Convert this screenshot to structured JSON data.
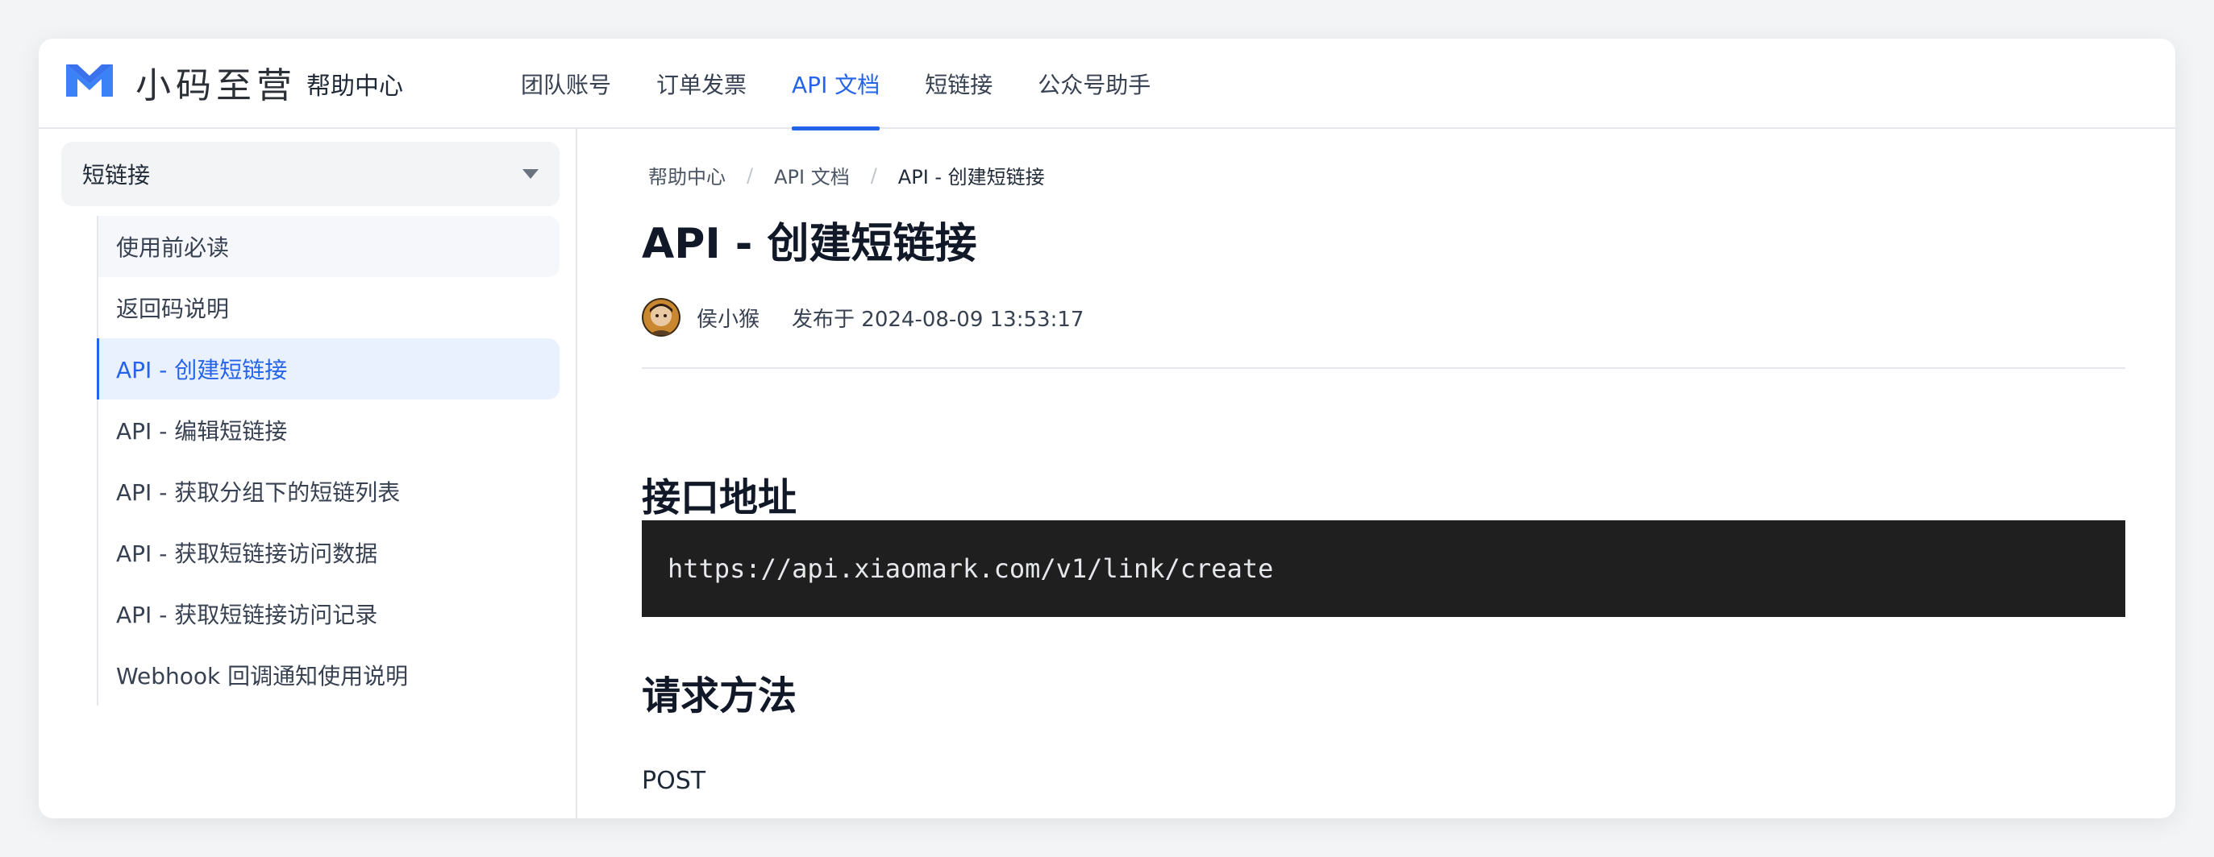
{
  "brand": {
    "logo_text": "小码至营",
    "logo_color": "#3b82f6"
  },
  "header": {
    "help_title": "帮助中心",
    "nav": [
      {
        "label": "团队账号",
        "active": false
      },
      {
        "label": "订单发票",
        "active": false
      },
      {
        "label": "API 文档",
        "active": true
      },
      {
        "label": "短链接",
        "active": false
      },
      {
        "label": "公众号助手",
        "active": false
      }
    ]
  },
  "sidebar": {
    "group_label": "短链接",
    "group_icon": "caret-down-icon",
    "items": [
      {
        "label": "使用前必读",
        "state": "hover"
      },
      {
        "label": "返回码说明",
        "state": ""
      },
      {
        "label": "API - 创建短链接",
        "state": "active"
      },
      {
        "label": "API - 编辑短链接",
        "state": ""
      },
      {
        "label": "API - 获取分组下的短链列表",
        "state": ""
      },
      {
        "label": "API - 获取短链接访问数据",
        "state": ""
      },
      {
        "label": "API - 获取短链接访问记录",
        "state": ""
      },
      {
        "label": "Webhook 回调通知使用说明",
        "state": ""
      }
    ]
  },
  "breadcrumb": {
    "items": [
      "帮助中心",
      "API 文档",
      "API - 创建短链接"
    ],
    "separator": "/"
  },
  "article": {
    "title": "API - 创建短链接",
    "author": "侯小猴",
    "published": "发布于 2024-08-09 13:53:17",
    "section1_heading": "接口地址",
    "endpoint": "https://api.xiaomark.com/v1/link/create",
    "section2_heading": "请求方法",
    "method": "POST"
  },
  "colors": {
    "accent": "#2563eb",
    "active_bg": "#eaf1fe",
    "code_bg": "#1f1f1f"
  }
}
